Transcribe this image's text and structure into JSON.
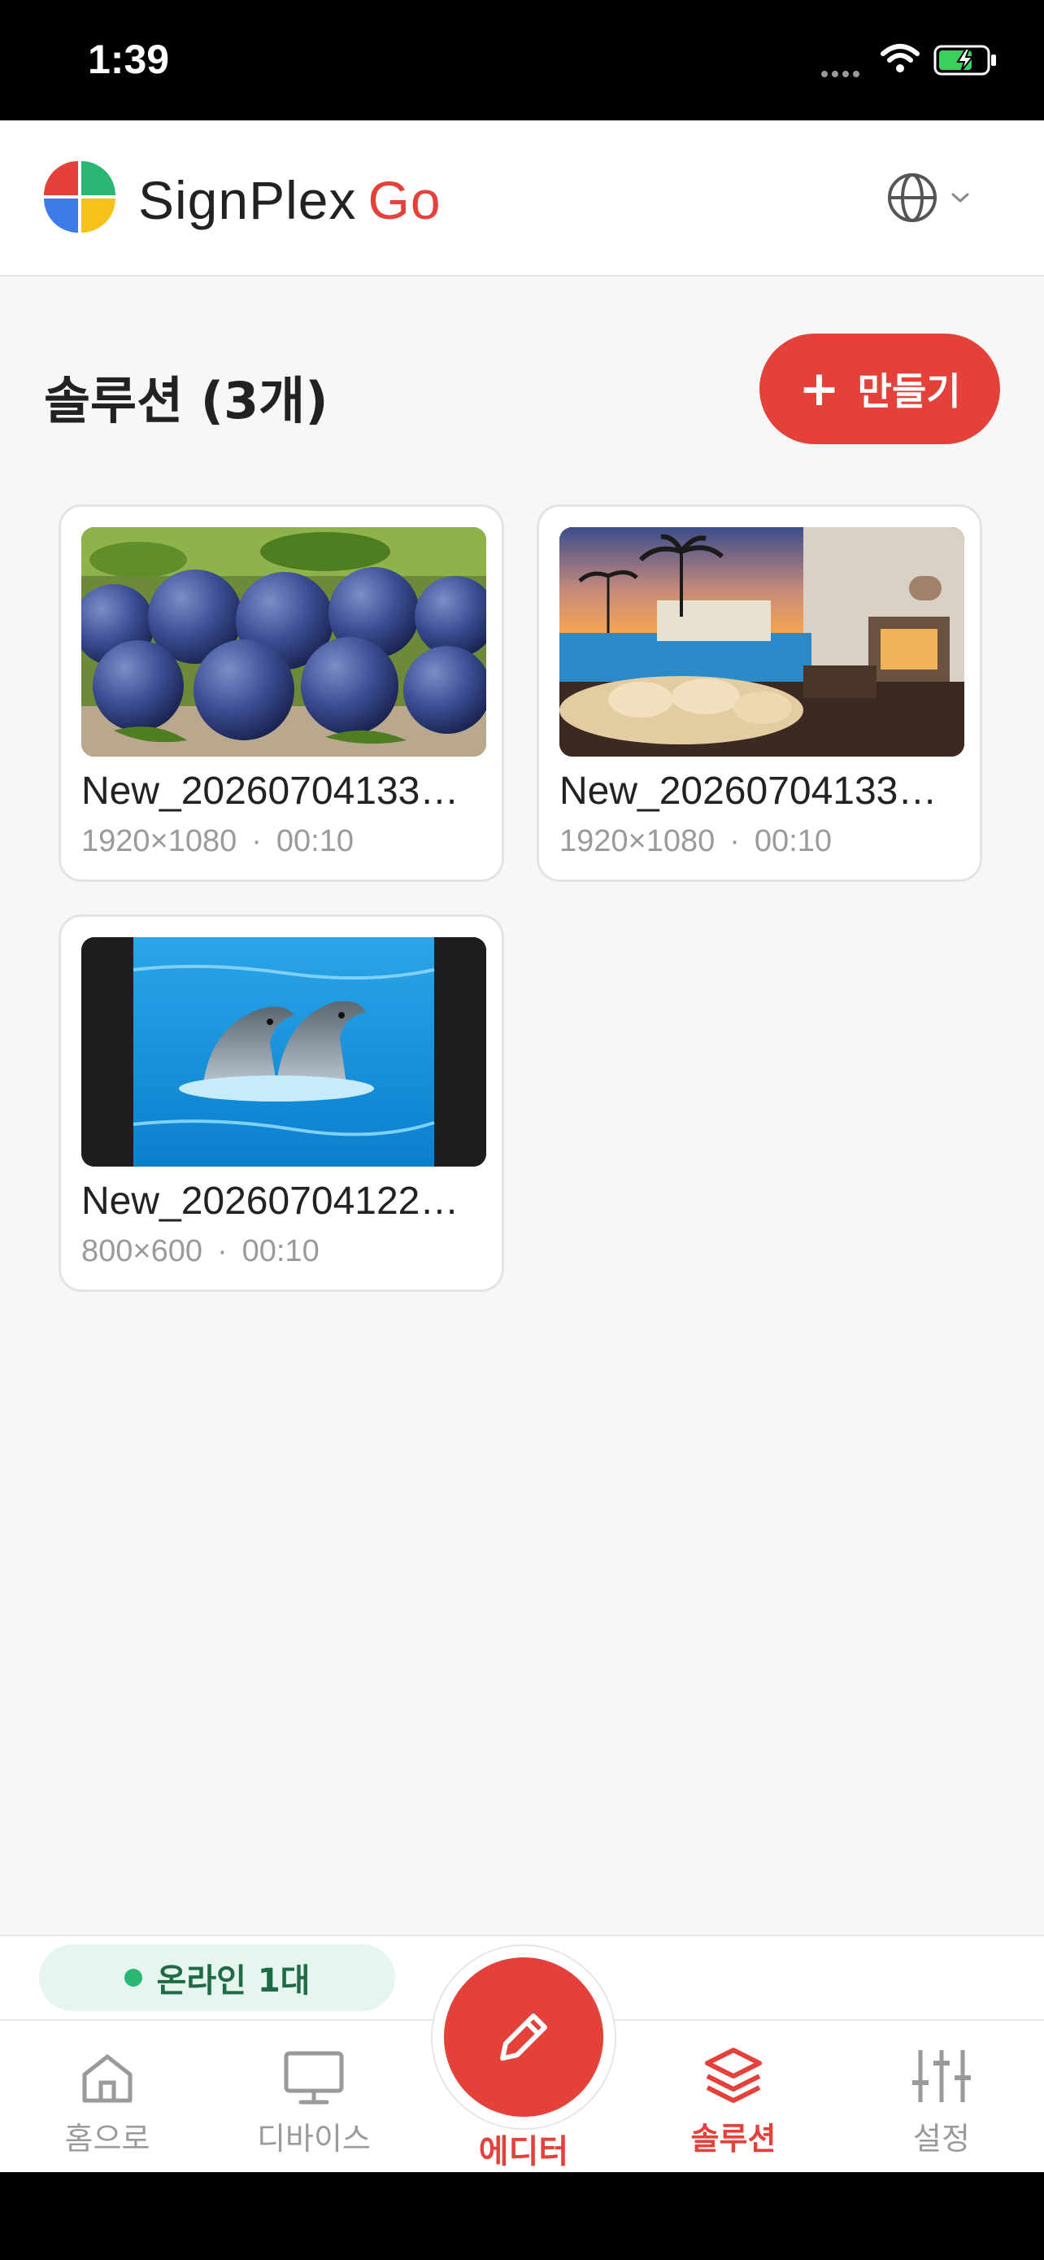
{
  "status_bar": {
    "time": "1:39"
  },
  "header": {
    "brand": "SignPlex",
    "brand_suffix": "Go",
    "icons": {
      "language": "globe-icon",
      "dropdown": "chevron-down-icon"
    }
  },
  "page": {
    "title": "솔루션 (3개)",
    "create_button": {
      "icon": "plus",
      "label": "만들기"
    }
  },
  "solutions": [
    {
      "name": "New_20260704133…",
      "resolution": "1920×1080",
      "separator": "·",
      "duration": "00:10",
      "thumbnail": "plums"
    },
    {
      "name": "New_20260704133…",
      "resolution": "1920×1080",
      "separator": "·",
      "duration": "00:10",
      "thumbnail": "resort-pool-lounge"
    },
    {
      "name": "New_20260704122…",
      "resolution": "800×600",
      "separator": "·",
      "duration": "00:10",
      "thumbnail": "dolphins"
    }
  ],
  "online_status": {
    "label": "온라인 1대"
  },
  "tabs": [
    {
      "label": "홈으로",
      "icon": "home-icon",
      "active": false
    },
    {
      "label": "디바이스",
      "icon": "monitor-icon",
      "active": false
    },
    {
      "label": "에디터",
      "icon": "pencil-icon",
      "active": false
    },
    {
      "label": "솔루션",
      "icon": "layers-icon",
      "active": true
    },
    {
      "label": "설정",
      "icon": "sliders-icon",
      "active": false
    }
  ],
  "colors": {
    "accent": "#e4413a",
    "online": "#2bb673",
    "background": "#f7f7f7"
  }
}
